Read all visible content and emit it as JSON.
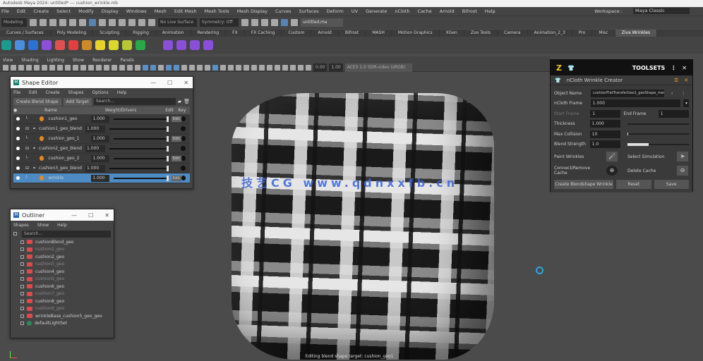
{
  "title": "Autodesk Maya 2024: untitled* --- cushion_wrinkle.mb",
  "menu": [
    "File",
    "Edit",
    "Create",
    "Select",
    "Modify",
    "Display",
    "Windows",
    "Mesh",
    "Edit Mesh",
    "Mesh Tools",
    "Mesh Display",
    "Curves",
    "Surfaces",
    "Deform",
    "UV",
    "Generate",
    "nCloth",
    "Cache",
    "Arnold",
    "Bifrost",
    "Help"
  ],
  "workspace": {
    "label": "Workspace :",
    "value": "Maya Classic"
  },
  "toolbar": {
    "mode": "Modeling",
    "symmetry": "No Live Surface",
    "symmetry2": "Symmetry: Off",
    "user": "untitled.ma"
  },
  "shelf_tabs": [
    "Curves / Surfaces",
    "Poly Modeling",
    "Sculpting",
    "Rigging",
    "Animation",
    "Rendering",
    "FX",
    "FX Caching",
    "Custom",
    "Arnold",
    "Bifrost",
    "MASH",
    "Motion Graphics",
    "XGen",
    "Zoo Tools",
    "Camera",
    "Animation_2_3",
    "Pro",
    "Misc",
    "Ziva Wrinkles"
  ],
  "shelf_icon_colors": [
    "#1b9b8f",
    "#4a8ee0",
    "#2f6fd6",
    "#8a4fe0",
    "#e05050",
    "#e04040",
    "#d2882a",
    "#e8d22a",
    "#d8d830",
    "#b8c830",
    "#2aa848",
    "#8a4fd8",
    "#8a4fd8",
    "#8a4fd8",
    "#8a4fd8"
  ],
  "panel_menu": [
    "View",
    "Shading",
    "Lighting",
    "Show",
    "Renderer",
    "Panels"
  ],
  "panel_fields": {
    "near": "0.00",
    "far": "1.00",
    "colorspace": "ACES 1.0 SDR-video (sRGB)"
  },
  "watermark": "技艺CG  www.qdnxxfb.cn",
  "help_line": "Editing blend shape target: cushion_geo1",
  "shape_editor": {
    "title": "Shape Editor",
    "menu": [
      "File",
      "Edit",
      "Create",
      "Shapes",
      "Options",
      "Help"
    ],
    "create_btn": "Create Blend Shape",
    "add_btn": "Add Target",
    "search": "Search...",
    "headers": [
      "Name",
      "Weight/Drivers",
      "Edit",
      "Key"
    ],
    "rows": [
      {
        "name": "cushion1_geo",
        "value": "1.000",
        "indent": 2,
        "target": true,
        "edit": "Edit"
      },
      {
        "name": "cushion1_geo_blend",
        "value": "1.000",
        "indent": 1,
        "target": false
      },
      {
        "name": "cushion_geo_1",
        "value": "1.000",
        "indent": 2,
        "target": true,
        "edit": "Edit"
      },
      {
        "name": "cushion2_geo_blend",
        "value": "1.000",
        "indent": 1,
        "target": false
      },
      {
        "name": "cushion_geo_2",
        "value": "1.000",
        "indent": 2,
        "target": true,
        "edit": "Edit"
      },
      {
        "name": "cushion3_geo_blend",
        "value": "1.000",
        "indent": 1,
        "target": false
      },
      {
        "name": "wrinkle",
        "value": "1.000",
        "indent": 2,
        "target": true,
        "edit": "Edit",
        "selected": true
      }
    ]
  },
  "outliner": {
    "title": "Outliner",
    "menu": [
      "Shapes",
      "Show",
      "Help"
    ],
    "search": "Search...",
    "items": [
      "cushionBlend_geo",
      "cushion1_geo",
      "cushion2_geo",
      "cushion3_geo",
      "cushion4_geo",
      "cushion5_geo",
      "cushion6_geo",
      "cushion7_geo",
      "cushion8_geo",
      "cushion9_geo",
      "wrinkleBase_cushion5_geo_geo",
      "defaultLightSet"
    ]
  },
  "toolsets": {
    "title": "TOOLSETS",
    "tool": "nCloth Wrinkle Creator",
    "object_name_label": "Object Name",
    "object_name": "cushionFlatTransferGeo1_geoShape_mesh",
    "frame_label": "nCloth Frame",
    "frame": "1.000",
    "start_label": "Start Frame",
    "start": "1",
    "end_label": "End Frame",
    "end": "1",
    "thickness_label": "Thickness",
    "thickness": "1.000",
    "collision_label": "Max Collision",
    "collision": "10",
    "collision_fill": 0.02,
    "iter_label": "Blend Strength",
    "iter": "1.0",
    "iter_fill": 0.35,
    "paint_label": "Paint Wrinkles",
    "select_label": "Select Simulation",
    "connect_label": "Connect/Remove Cache",
    "delete_label": "Delete Cache",
    "create_btn": "Create Blendshape Wrinkle",
    "reset_btn": "Reset",
    "save_btn": "Save"
  }
}
